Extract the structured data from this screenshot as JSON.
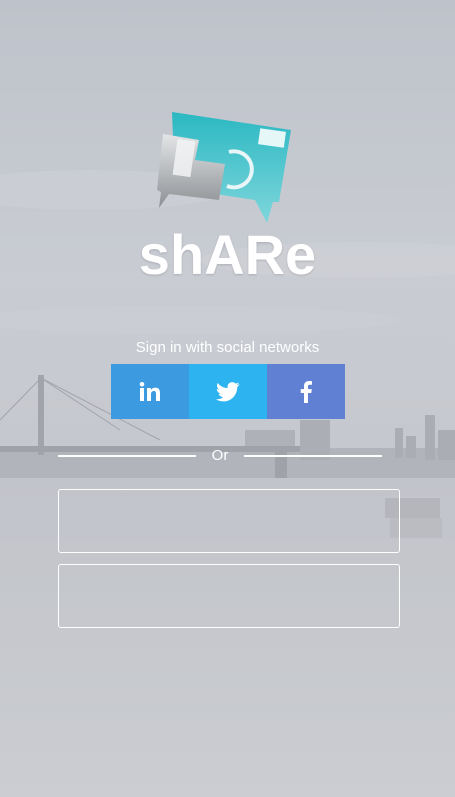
{
  "app": {
    "title": "shARe"
  },
  "social": {
    "label": "Sign in with social networks",
    "buttons": [
      {
        "name": "linkedin",
        "icon": "linkedin-icon",
        "text": "in",
        "color": "#3c9ae0"
      },
      {
        "name": "twitter",
        "icon": "twitter-icon",
        "color": "#2cb3f0"
      },
      {
        "name": "facebook",
        "icon": "facebook-icon",
        "text": "f",
        "color": "#5f80d3"
      }
    ]
  },
  "divider": {
    "text": "Or"
  },
  "form": {
    "username": {
      "value": "",
      "placeholder": ""
    },
    "password": {
      "value": "",
      "placeholder": ""
    }
  },
  "colors": {
    "accent_teal": "#2fbcc4",
    "text": "#ffffff"
  }
}
